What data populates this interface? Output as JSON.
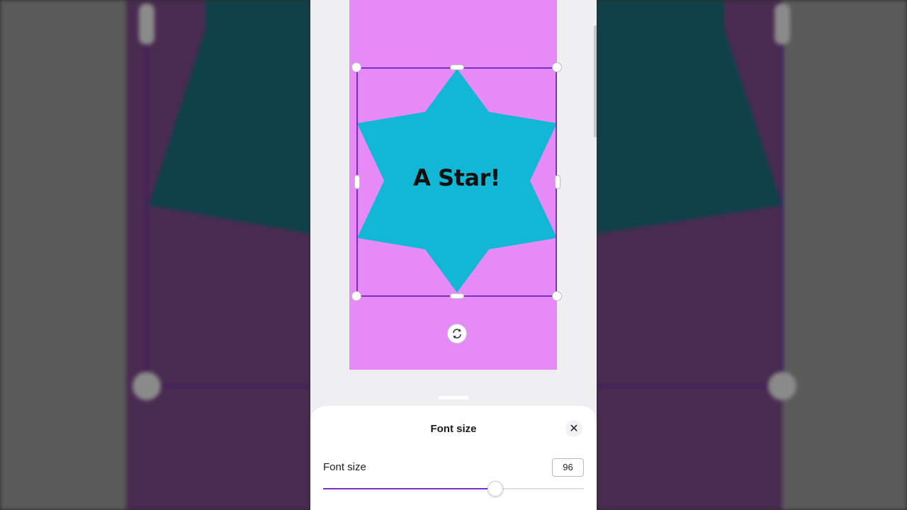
{
  "colors": {
    "canvas_bg": "#e68af7",
    "star": "#12b7d6",
    "selection": "#7a2fc4",
    "slider_fill": "#7a2fc4"
  },
  "canvas": {
    "text": "A Star!"
  },
  "icons": {
    "rotate": "rotate-icon",
    "close": "close-icon"
  },
  "sheet": {
    "title": "Font size",
    "close_glyph": "✕",
    "row_label": "Font size",
    "value": "96",
    "slider_fraction": 0.66
  }
}
